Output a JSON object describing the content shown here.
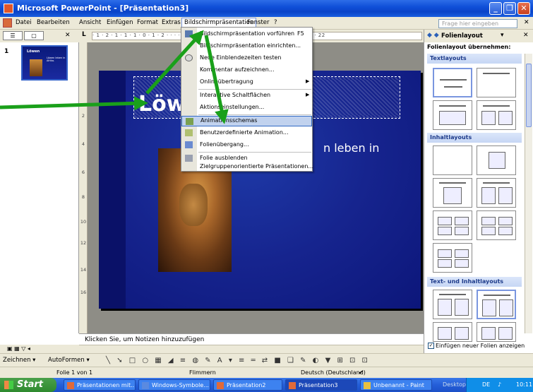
{
  "window": {
    "title": "Microsoft PowerPoint - [Präsentation3]"
  },
  "menubar": {
    "items": [
      "Datei",
      "Bearbeiten",
      "Ansicht",
      "Einfügen",
      "Format",
      "Extras",
      "Bildschirmpräsentation",
      "Fenster",
      "?"
    ],
    "help_placeholder": "Frage hier eingeben"
  },
  "ruler": {
    "h_text": "· 1 · 2 · 1 · 1 · 1 · 0 · 1 · 2 · · · · · · · · · · · · · · · 16 · 1 · 1 · 18 · 1 · 1 · 20 · 1 · 1 · 22",
    "v_marks": [
      "2",
      "4",
      "6",
      "8",
      "10",
      "12",
      "14",
      "16"
    ]
  },
  "thumbnail": {
    "number": "1",
    "title": "Löwen",
    "subtitle": "Löwen leben in Afrika."
  },
  "slide": {
    "title": "Löwen",
    "body": "n leben in"
  },
  "notes": {
    "placeholder": "Klicken Sie, um Notizen hinzuzufügen"
  },
  "menu_dropdown": {
    "items": [
      {
        "label": "Bildschirmpräsentation vorführen",
        "shortcut": "F5",
        "icon": "projector-icon"
      },
      {
        "label": "Bildschirmpräsentation einrichten...",
        "icon": ""
      },
      {
        "label": "Neue Einblendezeiten testen",
        "icon": "stopwatch-icon"
      },
      {
        "label": "Kommentar aufzeichnen...",
        "icon": ""
      },
      {
        "label": "Onlineübertragung",
        "submenu": true,
        "icon": ""
      },
      {
        "label": "Interaktive Schaltflächen",
        "submenu": true,
        "icon": ""
      },
      {
        "label": "Aktionseinstellungen...",
        "icon": ""
      },
      {
        "label": "Animationsschemas",
        "icon": "animation-icon",
        "highlighted": true
      },
      {
        "label": "Benutzerdefinierte Animation...",
        "icon": "custom-animation-icon"
      },
      {
        "label": "Folienübergang...",
        "icon": "transition-icon"
      },
      {
        "label": "Folie ausblenden",
        "icon": "hide-slide-icon"
      },
      {
        "label": "Zielgruppenorientierte Präsentationen...",
        "icon": ""
      }
    ]
  },
  "taskpane": {
    "title": "Folienlayout",
    "subtitle": "Folienlayout übernehmen:",
    "sections": [
      "Textlayouts",
      "Inhaltlayouts",
      "Text- und Inhaltlayouts"
    ],
    "checkbox_label": "Einfügen neuer Folien anzeigen"
  },
  "drawbar": {
    "zeichnen": "Zeichnen ▾",
    "autoformen": "AutoFormen ▾"
  },
  "status": {
    "slide": "Folie 1 von 1",
    "design": "Flimmern",
    "language": "Deutsch (Deutschland)"
  },
  "taskbar": {
    "start": "Start",
    "tasks": [
      "Präsentationen mit...",
      "Windows-Symbole...",
      "Präsentation2",
      "Präsentation3",
      "Unbenannt - Paint"
    ],
    "tray_desktop": "Desktop",
    "tray_lang": "DE",
    "clock": "10:11"
  },
  "colors": {
    "title_bar": "#0a43c8",
    "slide_bg": "#16248e",
    "menu_highlight": "#c1d2ee",
    "arrow": "#1aa01a"
  }
}
